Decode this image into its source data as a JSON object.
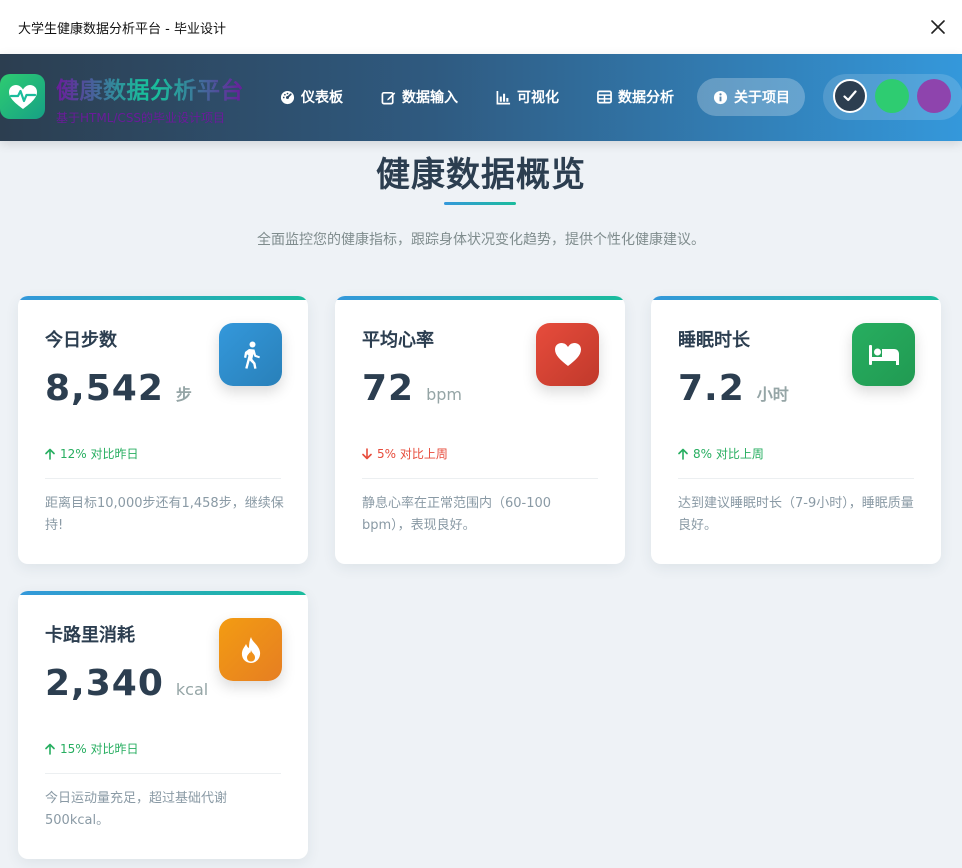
{
  "window": {
    "title": "大学生健康数据分析平台 - 毕业设计"
  },
  "brand": {
    "title": "健康数据分析平台",
    "subtitle": "基于HTML/CSS的毕业设计项目"
  },
  "nav": {
    "items": [
      {
        "label": "仪表板",
        "icon": "gauge-icon"
      },
      {
        "label": "数据输入",
        "icon": "edit-icon"
      },
      {
        "label": "可视化",
        "icon": "bar-chart-icon"
      },
      {
        "label": "数据分析",
        "icon": "table-icon"
      },
      {
        "label": "关于项目",
        "icon": "info-icon",
        "active": true
      }
    ]
  },
  "themes": {
    "colors": [
      "#2c3e50",
      "#2ecc71",
      "#8e44ad"
    ],
    "selected": 0
  },
  "main": {
    "title": "健康数据概览",
    "description": "全面监控您的健康指标，跟踪身体状况变化趋势，提供个性化健康建议。"
  },
  "cards": [
    {
      "title": "今日步数",
      "value": "8,542",
      "unit": "步",
      "icon": "walking-icon",
      "icon_colors": [
        "#3498db",
        "#2980b9"
      ],
      "trend_dir": "up",
      "trend": "12% 对比昨日",
      "note": "距离目标10,000步还有1,458步，继续保持!"
    },
    {
      "title": "平均心率",
      "value": "72",
      "unit": "bpm",
      "icon": "heart-icon",
      "icon_colors": [
        "#e74c3c",
        "#c0392b"
      ],
      "trend_dir": "down",
      "trend": "5% 对比上周",
      "note": "静息心率在正常范围内（60-100 bpm），表现良好。"
    },
    {
      "title": "睡眠时长",
      "value": "7.2",
      "unit": "小时",
      "icon": "bed-icon",
      "icon_colors": [
        "#27ae60",
        "#219a52"
      ],
      "trend_dir": "up",
      "trend": "8% 对比上周",
      "note": "达到建议睡眠时长（7-9小时），睡眠质量良好。"
    },
    {
      "title": "卡路里消耗",
      "value": "2,340",
      "unit": "kcal",
      "icon": "fire-icon",
      "icon_colors": [
        "#f39c12",
        "#e67e22"
      ],
      "trend_dir": "up",
      "trend": "15% 对比昨日",
      "note": "今日运动量充足，超过基础代谢500kcal。"
    }
  ]
}
